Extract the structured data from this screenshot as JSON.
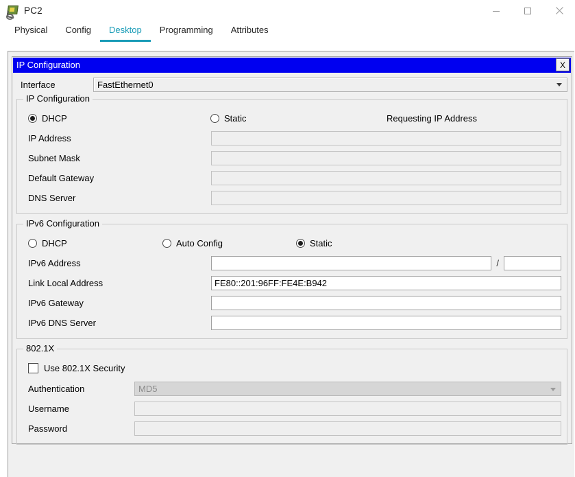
{
  "window": {
    "title": "PC2",
    "icon": "pc-device-icon",
    "controls": {
      "minimize": "minimize-icon",
      "maximize": "maximize-icon",
      "close": "close-icon"
    }
  },
  "tabs": [
    {
      "label": "Physical",
      "active": false
    },
    {
      "label": "Config",
      "active": false
    },
    {
      "label": "Desktop",
      "active": true
    },
    {
      "label": "Programming",
      "active": false
    },
    {
      "label": "Attributes",
      "active": false
    }
  ],
  "dialog": {
    "title": "IP Configuration",
    "close_label": "X",
    "header_color": "#0000f0",
    "accent_color": "#1a9cb7"
  },
  "interface": {
    "label": "Interface",
    "value": "FastEthernet0"
  },
  "ipv4": {
    "legend": "IP Configuration",
    "dhcp_label": "DHCP",
    "dhcp_selected": true,
    "static_label": "Static",
    "static_selected": false,
    "status": "Requesting IP Address",
    "fields": [
      {
        "label": "IP Address",
        "value": "",
        "disabled": true
      },
      {
        "label": "Subnet Mask",
        "value": "",
        "disabled": true
      },
      {
        "label": "Default Gateway",
        "value": "",
        "disabled": true
      },
      {
        "label": "DNS Server",
        "value": "",
        "disabled": true
      }
    ]
  },
  "ipv6": {
    "legend": "IPv6 Configuration",
    "dhcp_label": "DHCP",
    "dhcp_selected": false,
    "autoconfig_label": "Auto Config",
    "autoconfig_selected": false,
    "static_label": "Static",
    "static_selected": true,
    "address_label": "IPv6 Address",
    "address_value": "",
    "prefix_separator": "/",
    "prefix_value": "",
    "link_local_label": "Link Local Address",
    "link_local_value": "FE80::201:96FF:FE4E:B942",
    "gateway_label": "IPv6 Gateway",
    "gateway_value": "",
    "dns_label": "IPv6 DNS Server",
    "dns_value": ""
  },
  "dot1x": {
    "legend": "802.1X",
    "use_security_label": "Use 802.1X Security",
    "use_security_checked": false,
    "authentication_label": "Authentication",
    "authentication_value": "MD5",
    "username_label": "Username",
    "username_value": "",
    "password_label": "Password",
    "password_value": ""
  }
}
